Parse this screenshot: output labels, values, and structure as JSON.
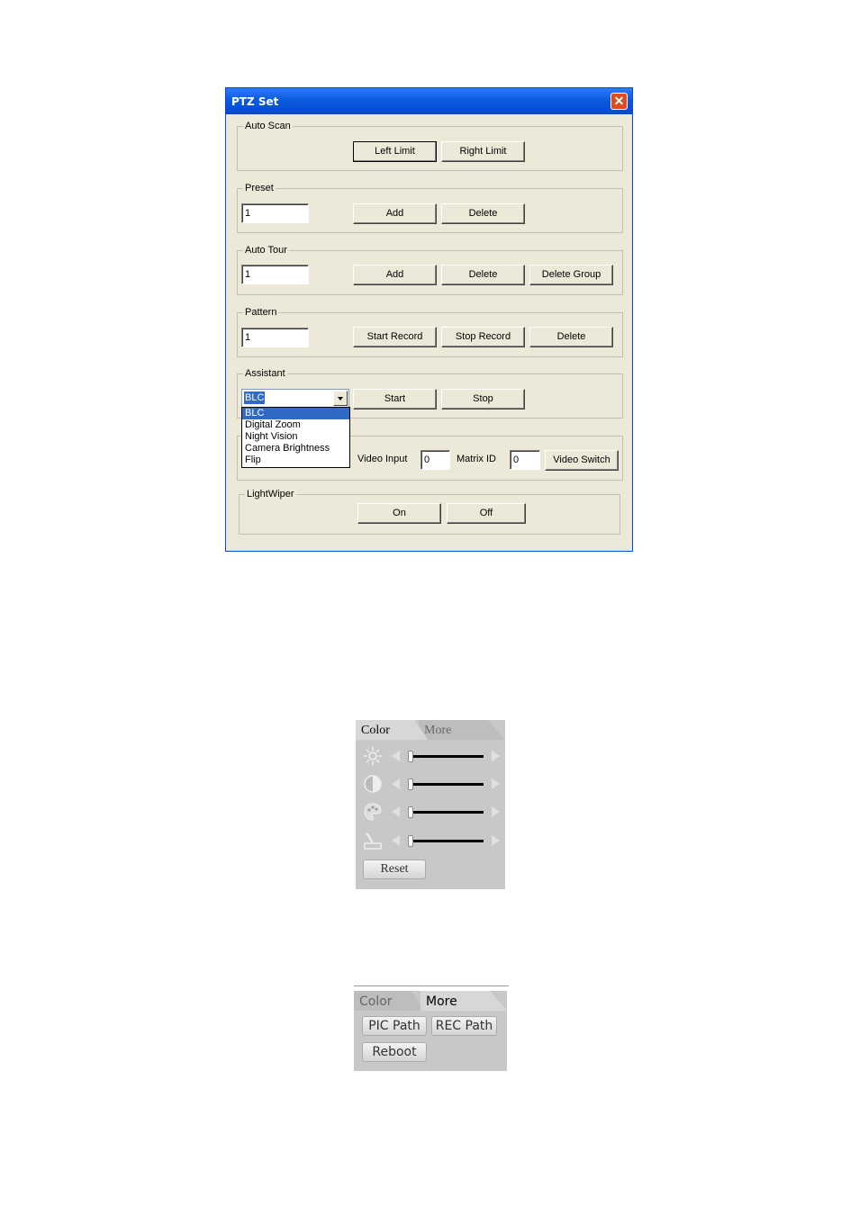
{
  "dialog": {
    "title": "PTZ Set",
    "auto_scan": {
      "legend": "Auto Scan",
      "left_limit": "Left Limit",
      "right_limit": "Right Limit"
    },
    "preset": {
      "legend": "Preset",
      "value": "1",
      "add": "Add",
      "delete": "Delete"
    },
    "auto_tour": {
      "legend": "Auto Tour",
      "value": "1",
      "add": "Add",
      "delete": "Delete",
      "delete_group": "Delete Group"
    },
    "pattern": {
      "legend": "Pattern",
      "value": "1",
      "start_record": "Start Record",
      "stop_record": "Stop Record",
      "delete": "Delete"
    },
    "assistant": {
      "legend": "Assistant",
      "selected": "BLC",
      "options": [
        "BLC",
        "Digital Zoom",
        "Night Vision",
        "Camera Brightness",
        "Flip"
      ],
      "start": "Start",
      "stop": "Stop"
    },
    "matrix": {
      "video_input_label": "Video Input",
      "video_input_value": "0",
      "matrix_id_label": "Matrix ID",
      "matrix_id_value": "0",
      "video_switch": "Video Switch"
    },
    "light_wiper": {
      "legend": "LightWiper",
      "on": "On",
      "off": "Off"
    }
  },
  "color_panel": {
    "tabs": [
      "Color",
      "More"
    ],
    "active_tab": "Color",
    "sliders": [
      {
        "icon": "brightness-icon",
        "value": 0.0
      },
      {
        "icon": "contrast-icon",
        "value": 0.0
      },
      {
        "icon": "saturation-icon",
        "value": 0.0
      },
      {
        "icon": "hue-icon",
        "value": 0.0
      }
    ],
    "reset": "Reset"
  },
  "more_panel": {
    "tabs": [
      "Color",
      "More"
    ],
    "active_tab": "More",
    "pic_path": "PIC Path",
    "rec_path": "REC Path",
    "reboot": "Reboot"
  }
}
